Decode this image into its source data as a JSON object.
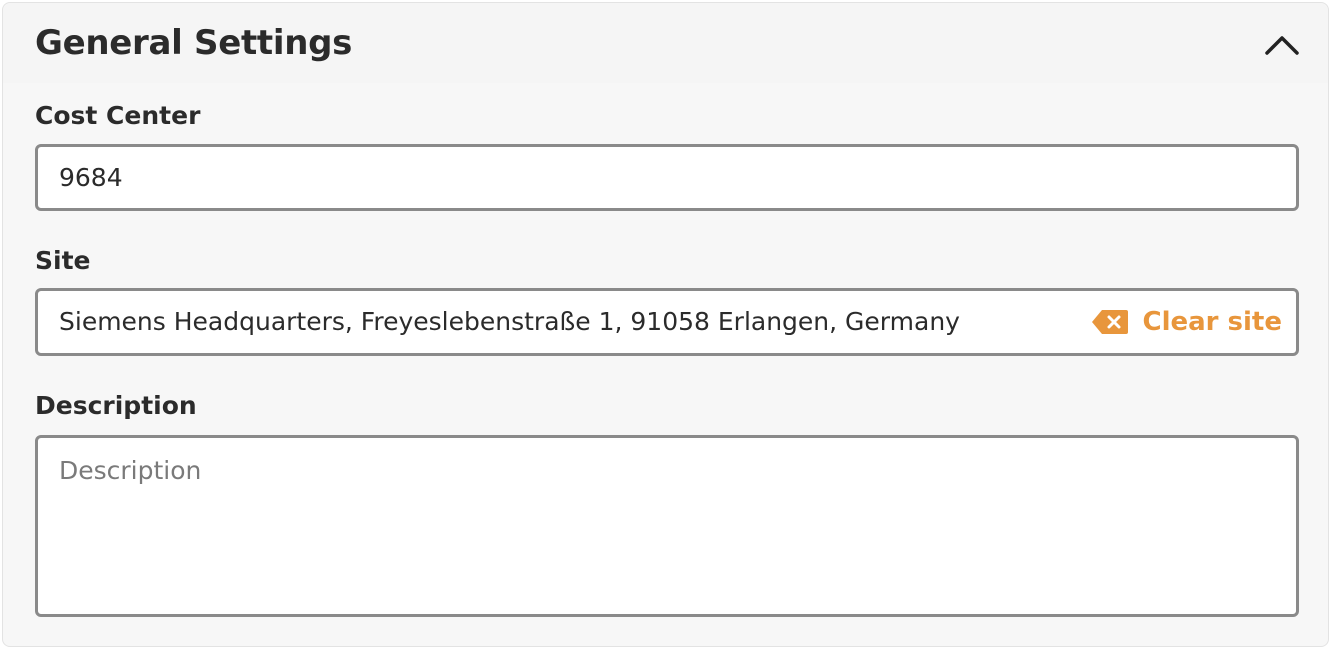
{
  "panel": {
    "title": "General Settings",
    "collapse_icon": "chevron-up-icon"
  },
  "cost_center": {
    "label": "Cost Center",
    "value": "9684"
  },
  "site": {
    "label": "Site",
    "value": "Siemens Headquarters, Freyeslebenstraße 1, 91058 Erlangen, Germany",
    "clear_label": "Clear site",
    "clear_icon": "backspace-icon",
    "accent_color": "#E8963C"
  },
  "description": {
    "label": "Description",
    "placeholder": "Description",
    "value": ""
  }
}
